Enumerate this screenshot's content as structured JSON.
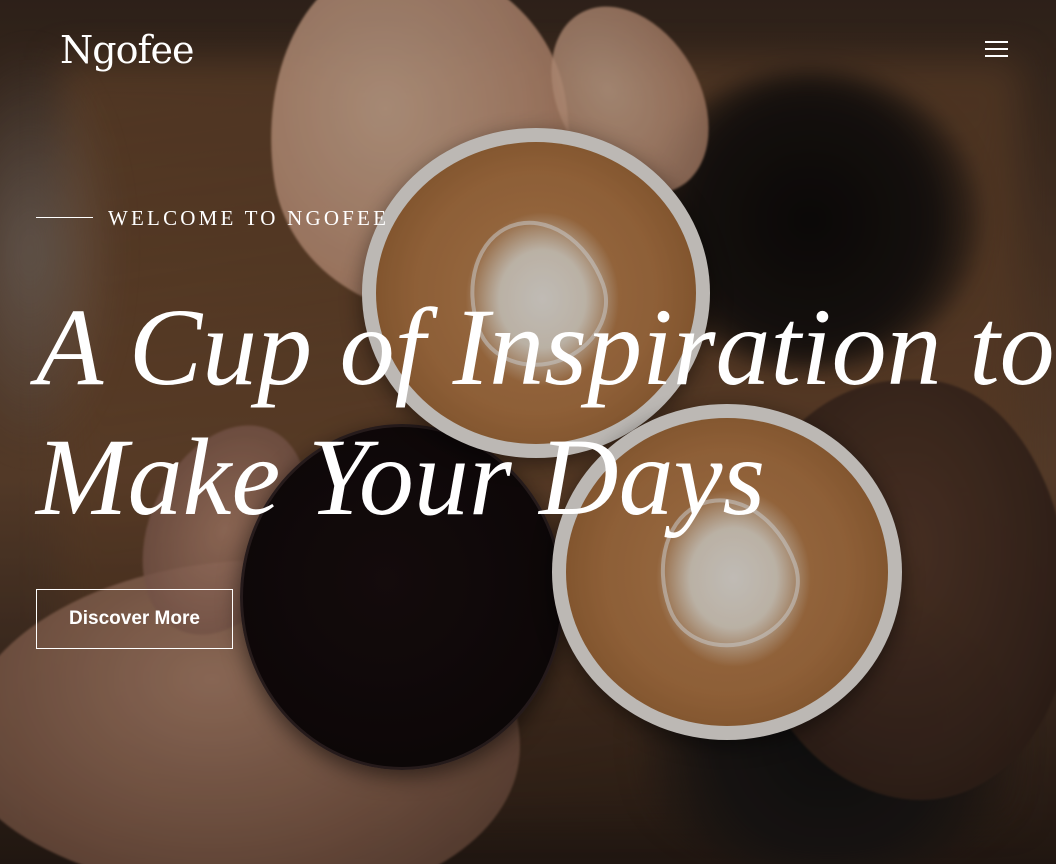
{
  "header": {
    "logo_text": "Ngofee",
    "menu_icon": "hamburger-menu-icon"
  },
  "hero": {
    "eyebrow": "WELCOME TO NGOFEE",
    "headline_line1": "A Cup of Inspiration to",
    "headline_line2": "Make Your Days",
    "cta_label": "Discover More"
  },
  "colors": {
    "text": "#ffffff",
    "overlay": "#000000"
  }
}
